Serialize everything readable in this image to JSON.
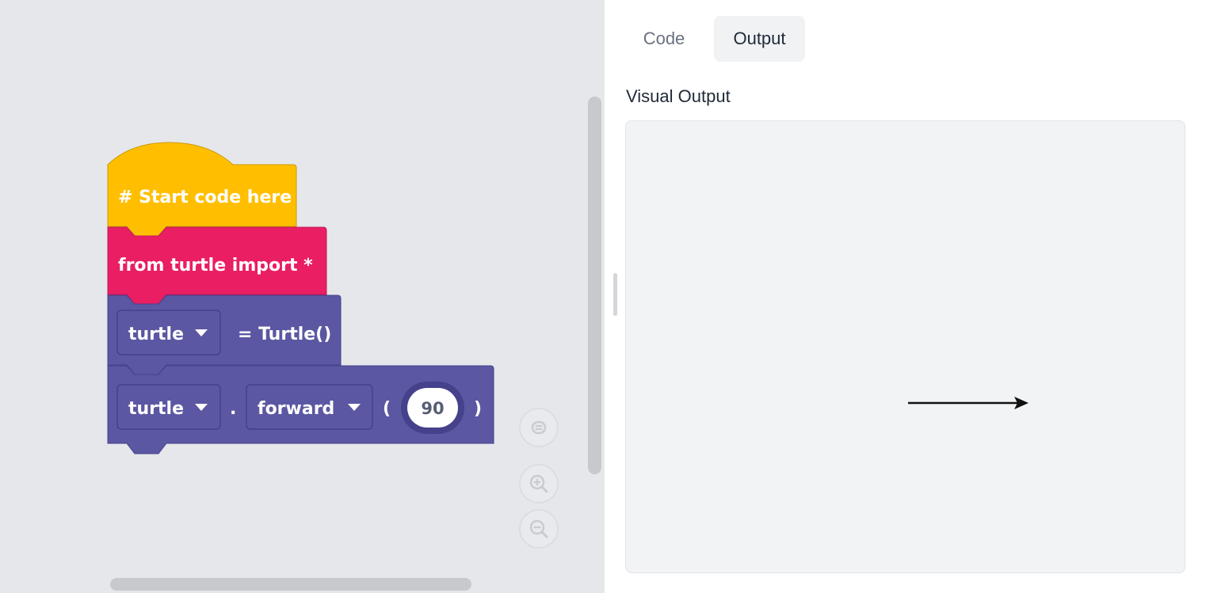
{
  "blocks": {
    "comment": "# Start code here",
    "import": "from turtle import *",
    "assign": {
      "variable": "turtle",
      "rhs": "= Turtle()"
    },
    "forward": {
      "object": "turtle",
      "dot": ".",
      "method": "forward",
      "open_paren": "(",
      "value": "90",
      "close_paren": ")"
    }
  },
  "tabs": {
    "code": "Code",
    "output": "Output"
  },
  "output": {
    "title": "Visual Output"
  },
  "colors": {
    "hat_block": "#ffbf00",
    "import_block": "#e91e63",
    "turtle_block": "#5b57a2"
  },
  "icons": {
    "reset_view": "reset-view-icon",
    "zoom_in": "zoom-in-icon",
    "zoom_out": "zoom-out-icon",
    "dropdown": "caret-down-icon",
    "turtle": "turtle-arrow-icon"
  }
}
